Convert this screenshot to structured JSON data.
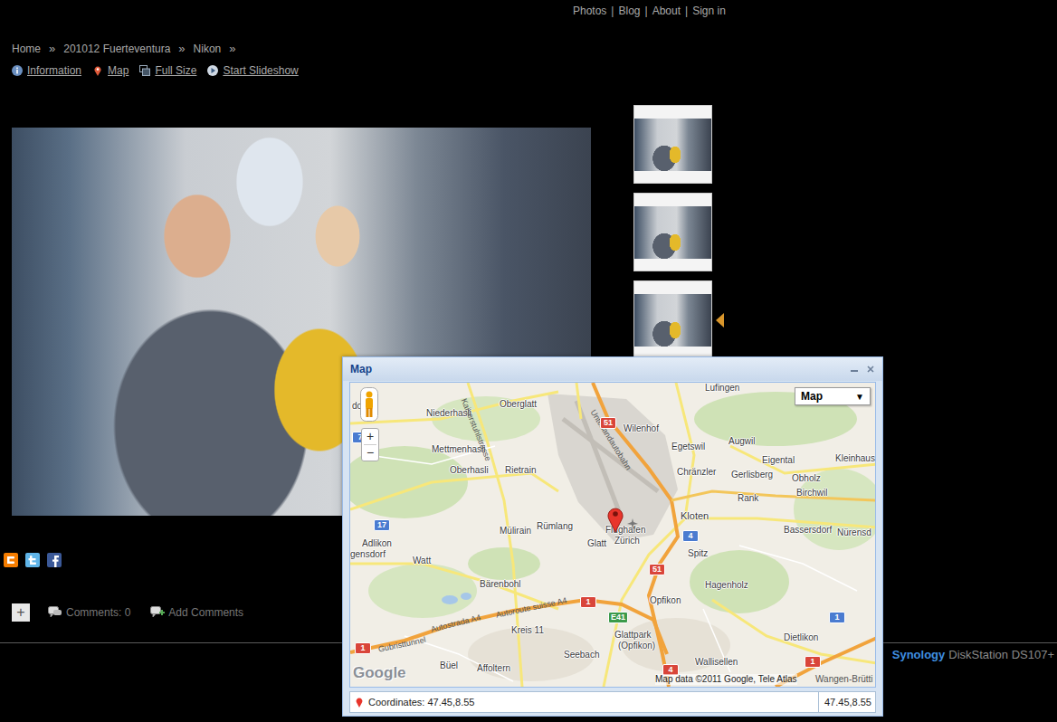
{
  "top_nav": {
    "items": [
      "Photos",
      "Blog",
      "About",
      "Sign in"
    ],
    "separator": "|"
  },
  "breadcrumb": {
    "items": [
      "Home",
      "201012 Fuerteventura",
      "Nikon"
    ],
    "separator": "»"
  },
  "actions": [
    {
      "label": "Information"
    },
    {
      "label": "Map"
    },
    {
      "label": "Full Size"
    },
    {
      "label": "Start Slideshow"
    }
  ],
  "thumbnails": [
    {
      "selected": false
    },
    {
      "selected": false
    },
    {
      "selected": true
    },
    {
      "selected": false
    }
  ],
  "comments": {
    "expand": "+",
    "count_label": "Comments: 0",
    "add_label": "Add Comments"
  },
  "footer": {
    "brand": "Synology",
    "model": "DiskStation DS107+"
  },
  "map_window": {
    "title": "Map",
    "type_select": "Map",
    "type_arrow": "▼",
    "zoom_in": "+",
    "zoom_out": "−",
    "labels": [
      "dorf",
      "Niederhasli",
      "Oberglatt",
      "Lufingen",
      "Wilenhof",
      "Egetswil",
      "Augwil",
      "Kleinhaus",
      "Mettmenhasli",
      "Eigental",
      "Chränzler",
      "Gerlisberg",
      "Obholz",
      "Oberhasli",
      "Rietrain",
      "Birchwil",
      "Rank",
      "Kloten",
      "Mülirain",
      "Rümlang",
      "Flughafen",
      "Zürich",
      "Bassersdorf",
      "Nürensd",
      "Adlikon",
      "Glatt",
      "Spitz",
      "gensdorf",
      "Watt",
      "Bärenbohl",
      "Hagenholz",
      "Opfikon",
      "Kreis 11",
      "Glattpark",
      "(Opfikon)",
      "Dietlikon",
      "Seebach",
      "Wallisellen",
      "Büel",
      "Affoltern"
    ],
    "road_labels": [
      "Kaiserstuhlstrasse",
      "Unterlandautobahn",
      "Gubristtunnel",
      "Autostrada A4",
      "Autoroute suisse A4"
    ],
    "shields": [
      {
        "text": "7",
        "color": "#4a7bd0"
      },
      {
        "text": "17",
        "color": "#4a7bd0"
      },
      {
        "text": "51",
        "color": "#d9453a"
      },
      {
        "text": "4",
        "color": "#4a7bd0"
      },
      {
        "text": "1",
        "color": "#4a7bd0"
      },
      {
        "text": "51",
        "color": "#d9453a"
      },
      {
        "text": "1",
        "color": "#d9453a"
      },
      {
        "text": "E41",
        "color": "#3b9a4a"
      },
      {
        "text": "4",
        "color": "#d9453a"
      },
      {
        "text": "1",
        "color": "#d9453a"
      },
      {
        "text": "1",
        "color": "#d9453a"
      }
    ],
    "attribution": "Map data ©2011 Google, Tele Atlas",
    "attribution_extra": "Wangen-Brütti",
    "logo": "Google",
    "coordinates_label": "Coordinates: 47.45,8.55",
    "coordinates_right": "47.45,8.55"
  }
}
